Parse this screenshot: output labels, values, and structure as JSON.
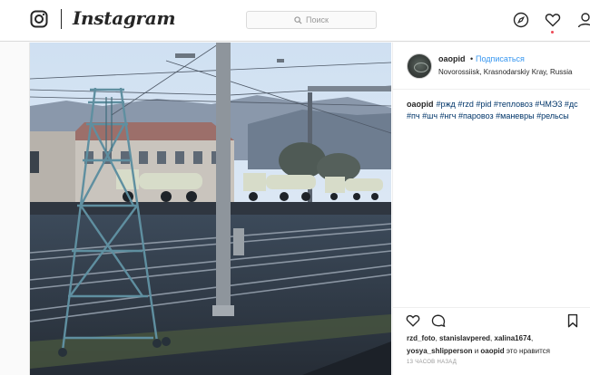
{
  "header": {
    "wordmark": "Instagram",
    "search_placeholder": "Поиск",
    "icons": [
      "instagram-glyph-icon",
      "search-icon",
      "compass-icon",
      "heart-icon",
      "profile-icon"
    ],
    "notification_color": "#ed4956"
  },
  "post": {
    "username": "oaopid",
    "separator": "•",
    "follow_label": "Подписаться",
    "location": "Novorossiisk, Krasnodarskiy Kray, Russia",
    "caption_author": "oaopid",
    "hashtags": [
      "#ржд",
      "#rzd",
      "#pid",
      "#тепловоз",
      "#ЧМЭ3",
      "#дс",
      "#пч",
      "#шч",
      "#нгч",
      "#паровоз",
      "#маневры",
      "#рельсы"
    ],
    "actions": [
      "like-icon",
      "comment-icon",
      "bookmark-icon"
    ],
    "likers": [
      "rzd_foto",
      "stanislavpered",
      "xalina1674",
      "yosya_shlipperson",
      "oaopid"
    ],
    "likes_suffix": "это нравится",
    "likes_and": "и",
    "timestamp": "13 ЧАСОВ НАЗАД",
    "photo_alt": "photo"
  },
  "colors": {
    "link": "#3897f0",
    "hashtag": "#003569",
    "border": "#dbdbdb"
  }
}
